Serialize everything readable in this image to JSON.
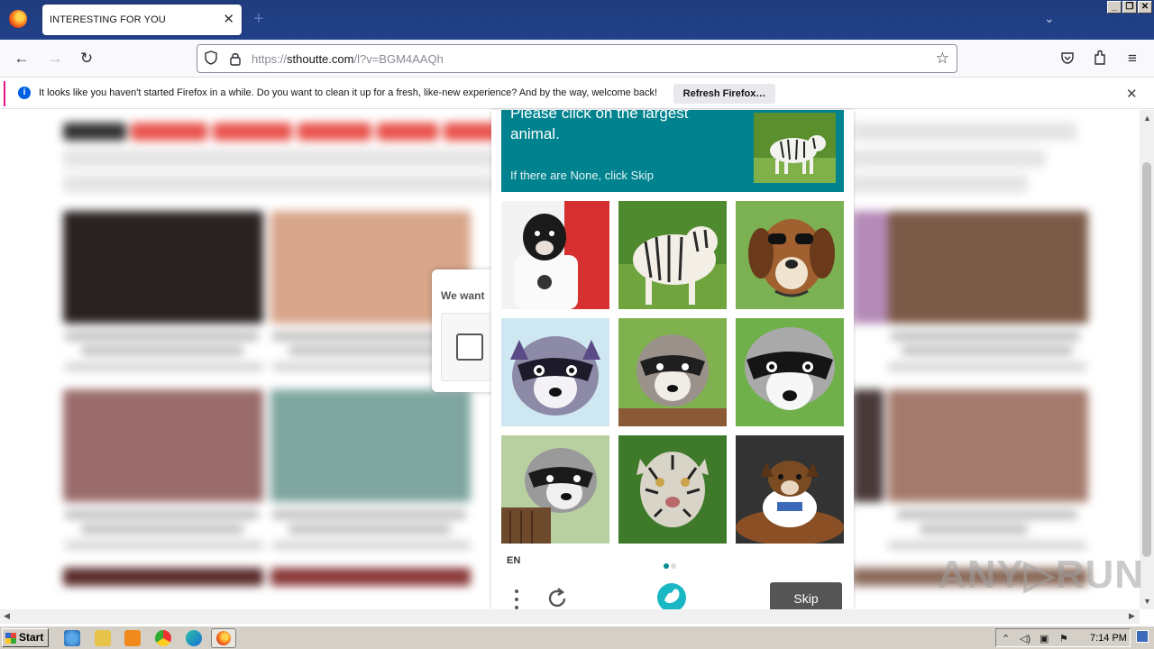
{
  "browser": {
    "tab_title": "INTERESTING FOR YOU",
    "url_prefix": "https://",
    "url_domain": "sthoutte.com",
    "url_path": "/l?v=BGM4AAQh"
  },
  "notification": {
    "message": "It looks like you haven't started Firefox in a while. Do you want to clean it up for a fresh, like-new experience? And by the way, welcome back!",
    "button_label": "Refresh Firefox…"
  },
  "consent": {
    "title": "We want"
  },
  "captcha": {
    "question": "Please click on the largest animal.",
    "subtext": "If there are None, click Skip",
    "example_image": "white-tiger",
    "language": "EN",
    "skip_label": "Skip",
    "images": [
      "dog-shirt",
      "tiger",
      "dog-sunglasses",
      "raccoon",
      "raccoon",
      "raccoon",
      "raccoon",
      "tiger",
      "dog-pillow"
    ],
    "accent_color": "#00838f"
  },
  "watermark": "ANY▷RUN",
  "taskbar": {
    "start_label": "Start",
    "clock": "7:14 PM",
    "pinned": [
      "ie-icon",
      "folder-icon",
      "media-player-icon",
      "chrome-icon",
      "edge-icon",
      "firefox-icon"
    ]
  }
}
